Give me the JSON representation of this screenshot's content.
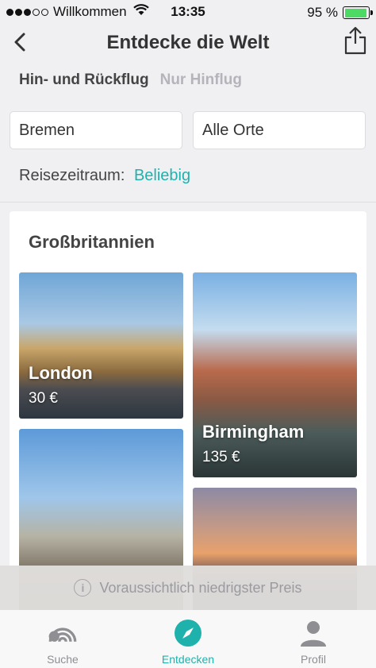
{
  "status": {
    "carrier": "Willkommen",
    "time": "13:35",
    "battery_text": "95 %",
    "battery_level": 0.95
  },
  "header": {
    "title": "Entdecke die Welt"
  },
  "trip_type": {
    "round_trip": "Hin- und Rückflug",
    "one_way": "Nur Hinflug",
    "selected": "round_trip"
  },
  "search": {
    "origin": "Bremen",
    "destination": "Alle Orte"
  },
  "period": {
    "label": "Reisezeitraum:",
    "value": "Beliebig"
  },
  "results": {
    "country": "Großbritannien",
    "destinations": [
      {
        "city": "London",
        "price": "30 €"
      },
      {
        "city": "Birmingham",
        "price": "135 €"
      }
    ]
  },
  "banner": {
    "text": "Voraussichtlich niedrigster Preis"
  },
  "tabs": [
    {
      "label": "Suche",
      "icon": "skyscanner-icon"
    },
    {
      "label": "Entdecken",
      "icon": "compass-icon"
    },
    {
      "label": "Profil",
      "icon": "person-icon"
    }
  ],
  "colors": {
    "accent": "#1fb2ad",
    "battery": "#4cd964"
  }
}
